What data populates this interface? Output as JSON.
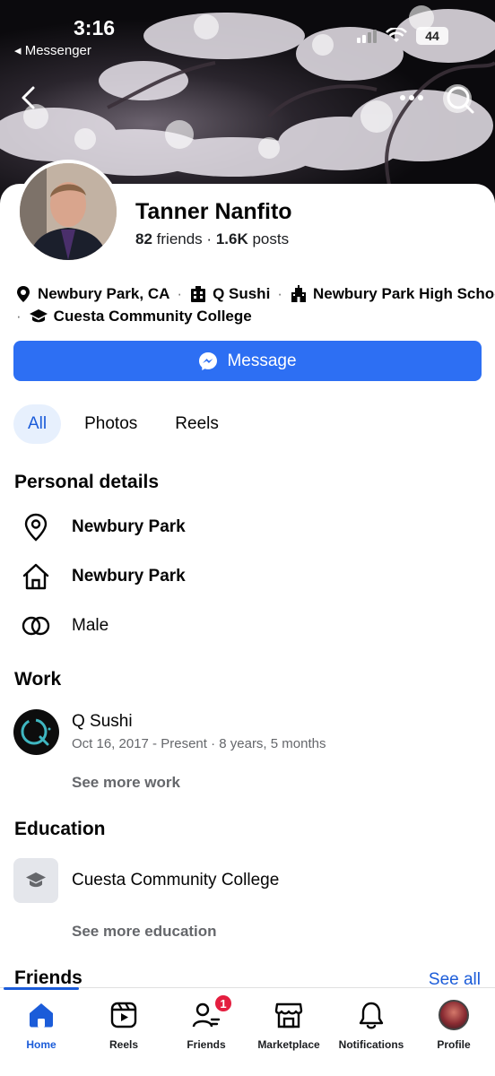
{
  "status_bar": {
    "time": "3:16",
    "back_app": "◂ Messenger",
    "battery": "44"
  },
  "profile": {
    "name": "Tanner Nanfito",
    "friends_count": "82",
    "friends_label": "friends",
    "posts_count": "1.6K",
    "posts_label": "posts"
  },
  "intro": {
    "location": "Newbury Park, CA",
    "work": "Q Sushi",
    "high_school": "Newbury Park High School",
    "college": "Cuesta Community College",
    "separator": "·"
  },
  "message_button": "Message",
  "tabs": [
    {
      "label": "All",
      "active": true
    },
    {
      "label": "Photos",
      "active": false
    },
    {
      "label": "Reels",
      "active": false
    }
  ],
  "personal_details": {
    "title": "Personal details",
    "items": [
      {
        "icon": "location-pin-icon",
        "text": "Newbury Park"
      },
      {
        "icon": "home-icon",
        "text": "Newbury Park"
      },
      {
        "icon": "gender-icon",
        "text": "Male"
      }
    ]
  },
  "work": {
    "title": "Work",
    "employer": "Q Sushi",
    "dates": "Oct 16, 2017 - Present · 8 years, 5 months",
    "see_more": "See more work"
  },
  "education": {
    "title": "Education",
    "school": "Cuesta Community College",
    "see_more": "See more education"
  },
  "friends": {
    "title": "Friends",
    "see_all": "See all"
  },
  "bottom_nav": [
    {
      "label": "Home",
      "icon": "home-icon",
      "active": true
    },
    {
      "label": "Reels",
      "icon": "reels-icon",
      "active": false
    },
    {
      "label": "Friends",
      "icon": "friends-icon",
      "active": false,
      "badge": "1"
    },
    {
      "label": "Marketplace",
      "icon": "marketplace-icon",
      "active": false
    },
    {
      "label": "Notifications",
      "icon": "bell-icon",
      "active": false
    },
    {
      "label": "Profile",
      "icon": "profile-avatar",
      "active": false
    }
  ],
  "colors": {
    "accent": "#2d6ff3",
    "link": "#1b5cd9",
    "badge": "#e41e3f",
    "muted": "#65676b"
  }
}
